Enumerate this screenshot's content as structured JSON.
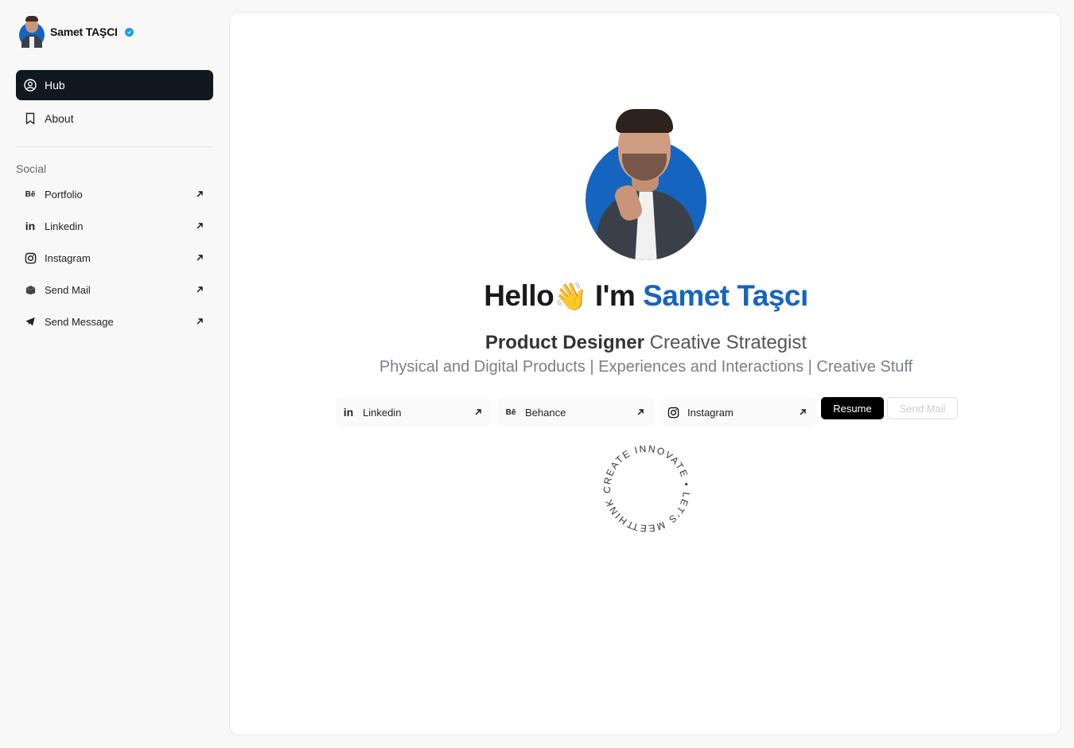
{
  "profile": {
    "name": "Samet TAŞCI",
    "verified_color": "#1d9bf0"
  },
  "nav": {
    "items": [
      {
        "label": "Hub",
        "icon": "user-circle-icon",
        "active": true
      },
      {
        "label": "About",
        "icon": "bookmark-icon",
        "active": false
      }
    ]
  },
  "social": {
    "title": "Social",
    "items": [
      {
        "label": "Portfolio",
        "icon": "behance-icon"
      },
      {
        "label": "Linkedin",
        "icon": "linkedin-icon"
      },
      {
        "label": "Instagram",
        "icon": "instagram-icon"
      },
      {
        "label": "Send Mail",
        "icon": "mail-icon"
      },
      {
        "label": "Send Message",
        "icon": "telegram-icon"
      }
    ]
  },
  "hero": {
    "hello": "Hello",
    "wave": "👋",
    "im": "I'm",
    "name": "Samet Taşcı",
    "role_bold": "Product Designer",
    "role_rest": "Creative Strategist",
    "subtitle": "Physical and Digital Products | Experiences and Interactions | Creative Stuff",
    "links": [
      {
        "label": "Linkedin",
        "icon": "linkedin-icon"
      },
      {
        "label": "Behance",
        "icon": "behance-icon"
      },
      {
        "label": "Instagram",
        "icon": "instagram-icon"
      }
    ],
    "resume_label": "Resume",
    "send_mail_label": "Send Mail",
    "circle_text": "THINK CREATE INNOVATE • LET'S MEET •"
  },
  "colors": {
    "accent": "#1565c0",
    "active_nav": "#101820"
  }
}
